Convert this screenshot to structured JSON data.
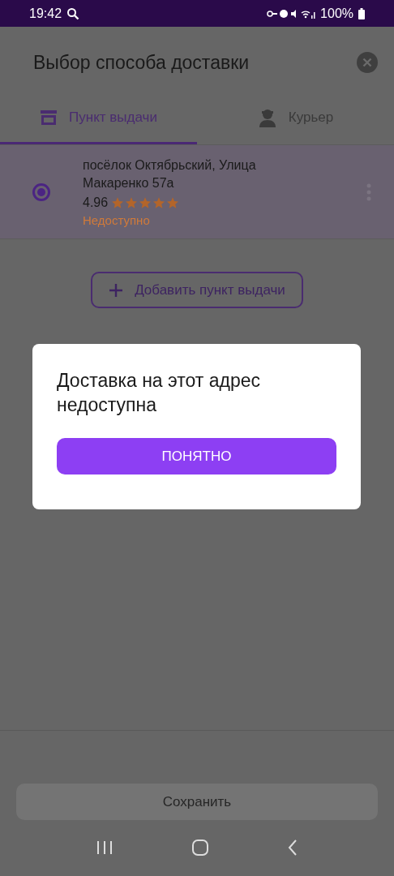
{
  "status_bar": {
    "time": "19:42",
    "battery": "100%"
  },
  "sheet": {
    "title": "Выбор способа доставки"
  },
  "tabs": [
    {
      "label": "Пункт выдачи",
      "selected": true,
      "kind": "store"
    },
    {
      "label": "Курьер",
      "selected": false,
      "kind": "courier"
    }
  ],
  "pickup_points": [
    {
      "address": "посёлок Октябрьский, Улица Макаренко 57а",
      "rating": "4.96",
      "stars": 5,
      "status": "Недоступно",
      "selected": true
    }
  ],
  "add_button": "Добавить пункт выдачи",
  "dialog": {
    "message": "Доставка на этот адрес недоступна",
    "button": "ПОНЯТНО"
  },
  "save_button": {
    "label": "Сохранить",
    "disabled": true
  }
}
